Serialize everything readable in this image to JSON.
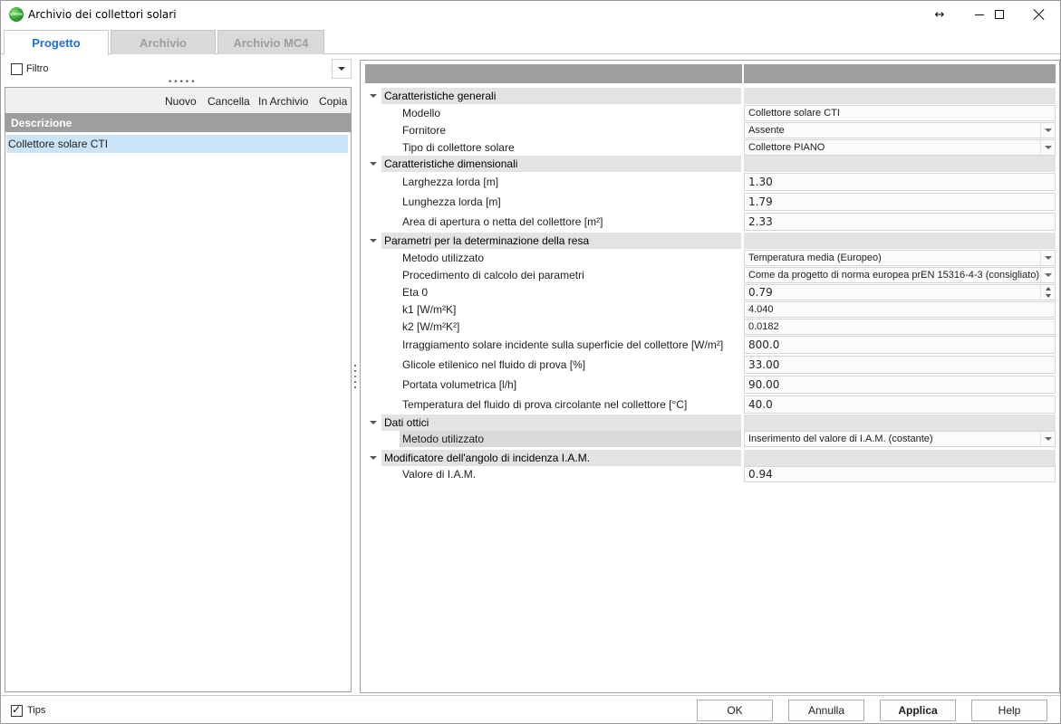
{
  "window": {
    "title": "Archivio dei collettori solari"
  },
  "tabs": [
    {
      "label": "Progetto",
      "active": true
    },
    {
      "label": "Archivio",
      "active": false
    },
    {
      "label": "Archivio MC4",
      "active": false
    }
  ],
  "filter": {
    "label": "Filtro",
    "checked": false
  },
  "left_toolbar": {
    "nuovo": "Nuovo",
    "cancella": "Cancella",
    "in_archivio": "In Archivio",
    "copia": "Copia"
  },
  "list": {
    "header": "Descrizione",
    "items": [
      "Collettore solare CTI"
    ],
    "selected_index": 0
  },
  "groups": [
    {
      "title": "Caratteristiche generali",
      "rows": [
        {
          "label": "Modello",
          "value": "Collettore solare CTI",
          "control": "text"
        },
        {
          "label": "Fornitore",
          "value": "Assente",
          "control": "dropdown"
        },
        {
          "label": "Tipo di collettore solare",
          "value": "Collettore PIANO",
          "control": "dropdown"
        }
      ]
    },
    {
      "title": "Caratteristiche dimensionali",
      "rows": [
        {
          "label": "Larghezza lorda [m]",
          "value": "1.30",
          "control": "number"
        },
        {
          "label": "Lunghezza lorda [m]",
          "value": "1.79",
          "control": "number"
        },
        {
          "label": "Area di apertura o netta del collettore [m²]",
          "value": "2.33",
          "control": "number"
        }
      ]
    },
    {
      "title": "Parametri per la determinazione della resa",
      "rows": [
        {
          "label": "Metodo utilizzato",
          "value": "Temperatura media (Europeo)",
          "control": "dropdown"
        },
        {
          "label": "Procedimento di calcolo dei parametri",
          "value": "Come da progetto di norma europea prEN 15316-4-3 (consigliato)",
          "control": "dropdown"
        },
        {
          "label": "Eta 0",
          "value": "0.79",
          "control": "spin"
        },
        {
          "label": "k1 [W/m²K]",
          "value": "4.040",
          "control": "readonly"
        },
        {
          "label": "k2 [W/m²K²]",
          "value": "0.0182",
          "control": "readonly"
        },
        {
          "label": "Irraggiamento solare incidente sulla superficie del collettore [W/m²]",
          "value": "800.0",
          "control": "number"
        },
        {
          "label": "Glicole etilenico nel fluido di prova [%]",
          "value": "33.00",
          "control": "number"
        },
        {
          "label": "Portata volumetrica [l/h]",
          "value": "90.00",
          "control": "number"
        },
        {
          "label": "Temperatura del fluido di prova circolante nel collettore [°C]",
          "value": "40.0",
          "control": "number"
        }
      ]
    },
    {
      "title": "Dati ottici",
      "rows": [
        {
          "label": "Metodo utilizzato",
          "value": "Inserimento del valore di I.A.M. (costante)",
          "control": "dropdown",
          "selected": true
        }
      ]
    },
    {
      "title": "Modificatore dell'angolo di incidenza I.A.M.",
      "rows": [
        {
          "label": "Valore di I.A.M.",
          "value": "0.94",
          "control": "number"
        }
      ]
    }
  ],
  "bottom": {
    "tips": {
      "label": "Tips",
      "checked": true
    },
    "buttons": {
      "ok": "OK",
      "annulla": "Annulla",
      "applica": "Applica",
      "help": "Help"
    }
  },
  "colors": {
    "active_tab": "#1f6fd1",
    "header_gray": "#9e9e9e",
    "selection": "#cce4f7"
  }
}
